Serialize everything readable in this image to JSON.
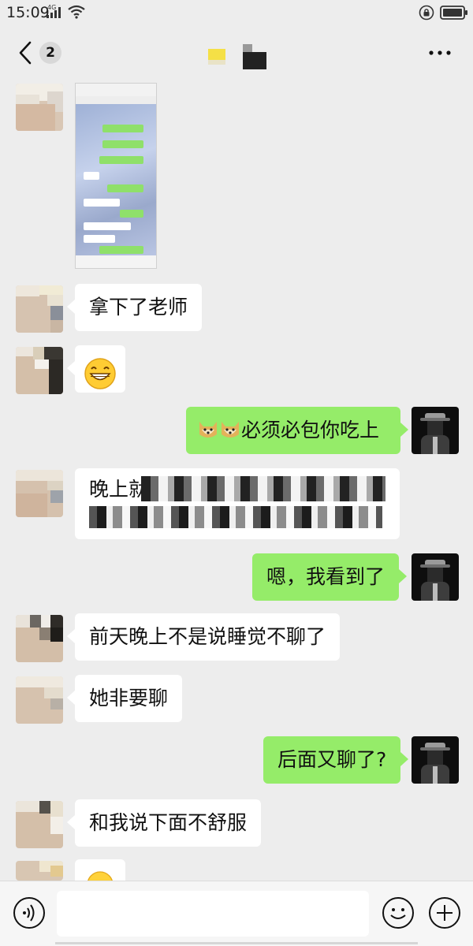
{
  "status_bar": {
    "time": "15:09",
    "network": "4G",
    "icons": [
      "signal-icon",
      "wifi-icon",
      "lock-icon",
      "battery-icon"
    ]
  },
  "nav": {
    "back_icon": "chevron-left-icon",
    "unread_count": "2",
    "more_icon": "more-dots-icon"
  },
  "colors": {
    "background": "#ededed",
    "bubble_self": "#95ec69",
    "bubble_other": "#ffffff",
    "input_bar": "#f6f6f6"
  },
  "messages": [
    {
      "side": "left",
      "type": "image"
    },
    {
      "side": "left",
      "type": "text",
      "text": "拿下了老师"
    },
    {
      "side": "left",
      "type": "emoji",
      "emoji": "grinning-face-icon"
    },
    {
      "side": "right",
      "type": "text",
      "emojis": [
        "doge-icon",
        "doge-icon"
      ],
      "text": "必须必包你吃上"
    },
    {
      "side": "left",
      "type": "text",
      "text": "晚上就换着...",
      "partially_obscured": true
    },
    {
      "side": "right",
      "type": "text",
      "text": "嗯，我看到了"
    },
    {
      "side": "left",
      "type": "text",
      "text": "前天晚上不是说睡觉不聊了"
    },
    {
      "side": "left",
      "type": "text",
      "text": "她非要聊"
    },
    {
      "side": "right",
      "type": "text",
      "text": "后面又聊了?"
    },
    {
      "side": "left",
      "type": "text",
      "text": "和我说下面不舒服"
    },
    {
      "side": "left",
      "type": "emoji",
      "emoji": "smile-face-icon",
      "partially_visible": true
    }
  ],
  "input_bar": {
    "voice_icon": "voice-icon",
    "input_value": "",
    "emoji_icon": "emoji-icon",
    "plus_icon": "plus-icon"
  }
}
